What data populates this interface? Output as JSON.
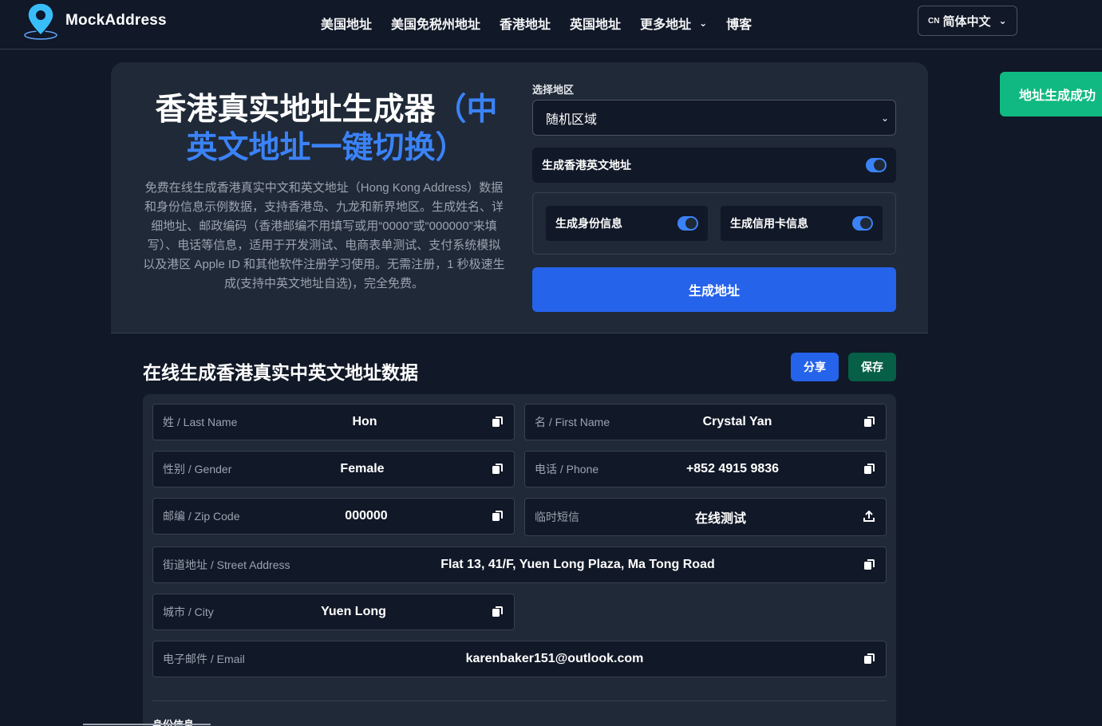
{
  "nav": {
    "brand": "MockAddress",
    "items": [
      "美国地址",
      "美国免税州地址",
      "香港地址",
      "英国地址",
      "更多地址",
      "博客"
    ],
    "lang_flag": "CN",
    "lang_label": "简体中文"
  },
  "toast": "地址生成成功",
  "hero": {
    "title_main": "香港真实地址生成器",
    "title_accent_1": "（中",
    "title_accent_2": "英文地址一键切换）",
    "description": "免费在线生成香港真实中文和英文地址（Hong Kong Address）数据和身份信息示例数据，支持香港岛、九龙和新界地区。生成姓名、详细地址、邮政编码（香港邮编不用填写或用“0000”或“000000”来填写）、电话等信息，适用于开发测试、电商表单测试、支付系统模拟以及港区 Apple ID 和其他软件注册学习使用。无需注册，1 秒极速生成(支持中英文地址自选)，完全免费。"
  },
  "form": {
    "region_label": "选择地区",
    "region_value": "随机区域",
    "toggle_english": "生成香港英文地址",
    "toggle_identity": "生成身份信息",
    "toggle_card": "生成信用卡信息",
    "generate_button": "生成地址"
  },
  "result": {
    "title": "在线生成香港真实中英文地址数据",
    "share_button": "分享",
    "save_button": "保存",
    "fields": {
      "last_name": {
        "label": "姓 / Last Name",
        "value": "Hon"
      },
      "first_name": {
        "label": "名 / First Name",
        "value": "Crystal Yan"
      },
      "gender": {
        "label": "性别 / Gender",
        "value": "Female"
      },
      "phone": {
        "label": "电话 / Phone",
        "value": "+852 4915 9836"
      },
      "zip": {
        "label": "邮编 / Zip Code",
        "value": "000000"
      },
      "sms": {
        "label": "临时短信",
        "value": "在线测试"
      },
      "street": {
        "label": "街道地址 / Street Address",
        "value": "Flat 13, 41/F, Yuen Long Plaza, Ma Tong Road"
      },
      "city": {
        "label": "城市 / City",
        "value": "Yuen Long"
      },
      "email": {
        "label": "电子邮件 / Email",
        "value": "karenbaker151@outlook.com"
      }
    },
    "identity_title": "身份信息"
  },
  "colors": {
    "background": "#111827",
    "card": "#1f2937",
    "primary": "#2563eb",
    "accent": "#3b82f6",
    "success": "#10b981",
    "save": "#065f46"
  },
  "icons": {
    "logo": "map-pin-icon",
    "copy": "copy-icon",
    "external": "external-link-icon",
    "chevron": "chevron-down-icon"
  }
}
